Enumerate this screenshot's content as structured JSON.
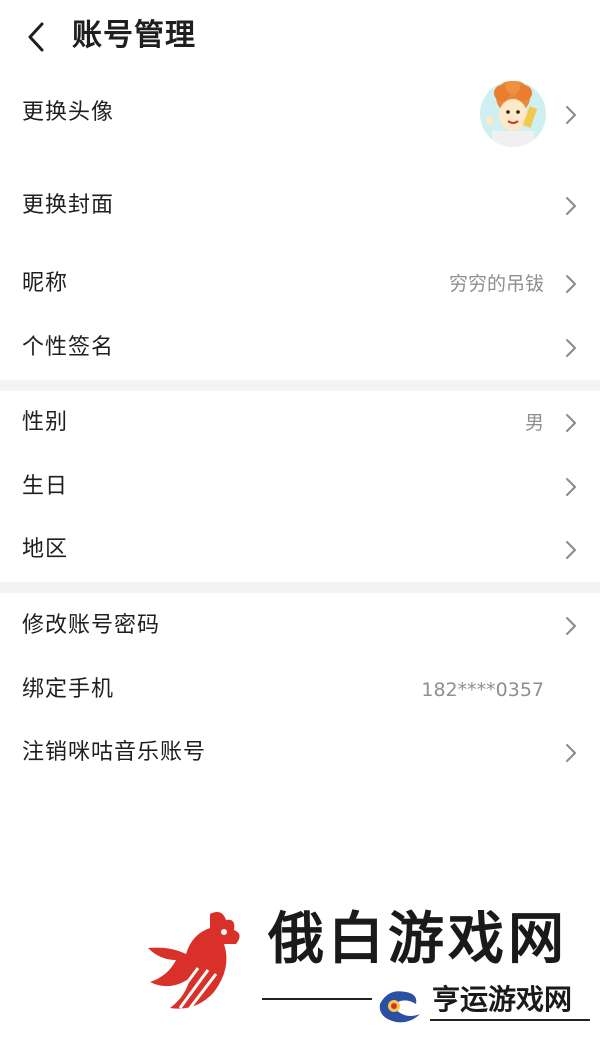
{
  "header": {
    "title": "账号管理"
  },
  "groups": [
    {
      "items": [
        {
          "label": "更换头像",
          "value": ""
        },
        {
          "label": "更换封面",
          "value": ""
        },
        {
          "label": "昵称",
          "value": "穷穷的吊钹"
        },
        {
          "label": "个性签名",
          "value": ""
        }
      ]
    },
    {
      "items": [
        {
          "label": "性别",
          "value": "男"
        },
        {
          "label": "生日",
          "value": ""
        },
        {
          "label": "地区",
          "value": ""
        }
      ]
    },
    {
      "items": [
        {
          "label": "修改账号密码",
          "value": ""
        },
        {
          "label": "绑定手机",
          "value": "182****0357"
        },
        {
          "label": "注销咪咕音乐账号",
          "value": ""
        }
      ]
    }
  ],
  "watermark": {
    "main": "俄白游戏网",
    "sub": "亨运游戏网"
  },
  "colors": {
    "separator": "#f4f4f6",
    "value_text": "#8f8f8f",
    "chevron": "#8a8a8a",
    "watermark_red": "#d9302a"
  }
}
